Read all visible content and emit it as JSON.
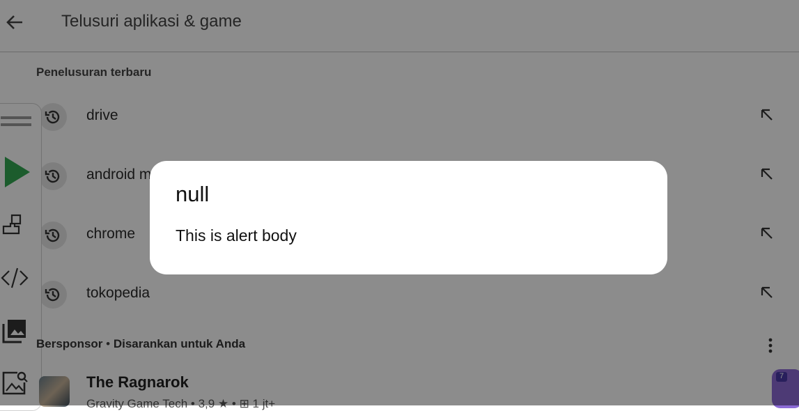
{
  "header": {
    "search_placeholder": "Telusuri aplikasi & game"
  },
  "recent": {
    "label": "Penelusuran terbaru",
    "items": [
      {
        "label": "drive"
      },
      {
        "label": "android m"
      },
      {
        "label": "chrome"
      },
      {
        "label": "tokopedia"
      }
    ]
  },
  "sponsored": {
    "tag": "Bersponsor",
    "separator": "•",
    "subtitle": "Disarankan untuk Anda"
  },
  "app": {
    "title": "The Ragnarok",
    "meta": "Gravity Game Tech • 3,9 ★ • ⊞ 1 jt+",
    "badge": "7"
  },
  "dialog": {
    "title": "null",
    "body": "This is alert body"
  },
  "colors": {
    "scrim": "#000000",
    "play_green": "#34a853",
    "dialog_bg": "#ffffff"
  }
}
